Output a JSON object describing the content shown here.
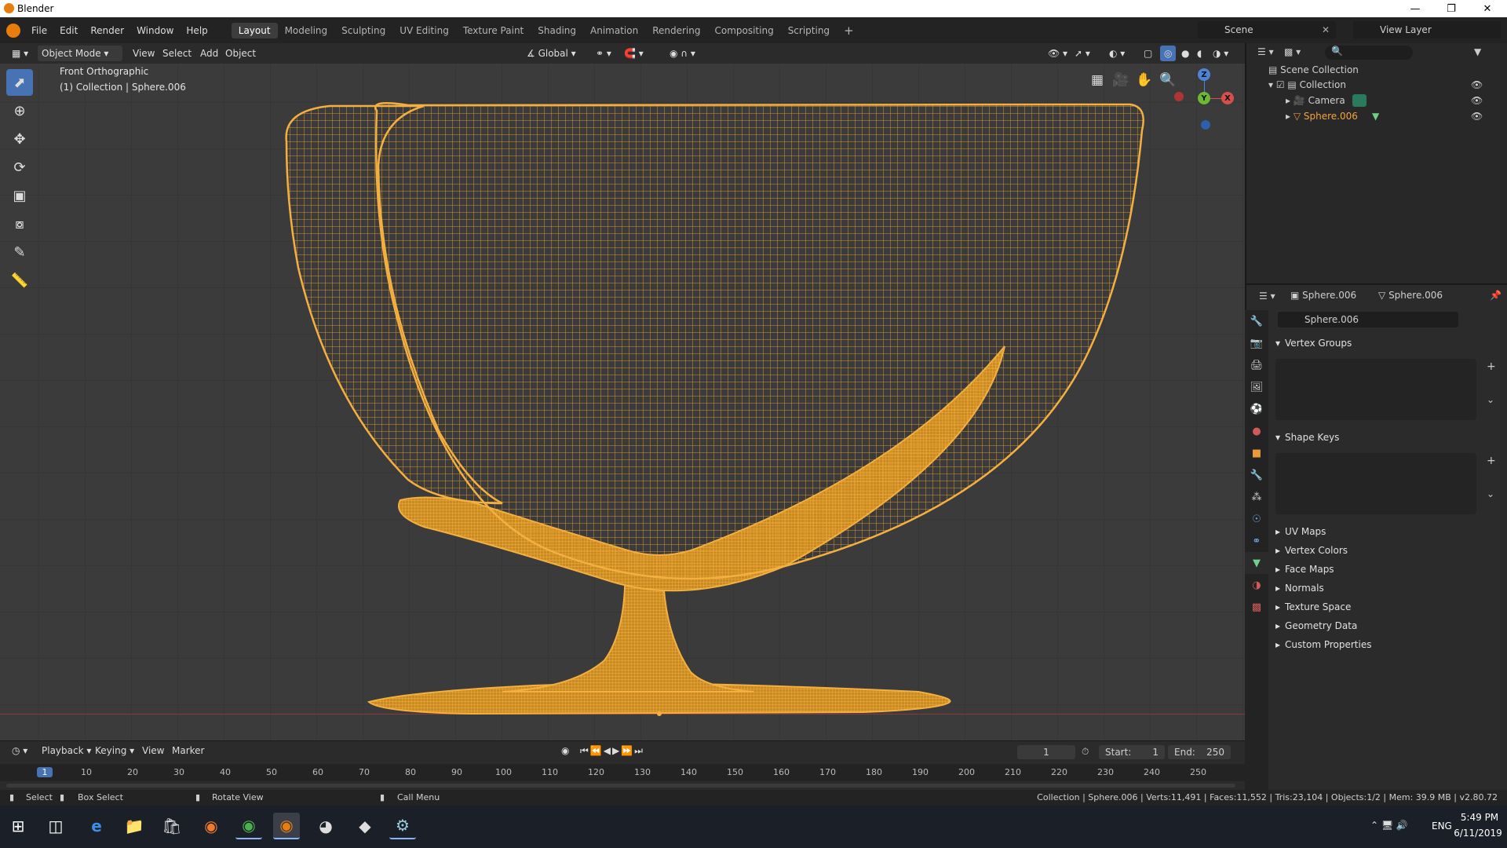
{
  "window": {
    "title": "Blender"
  },
  "menus": [
    "File",
    "Edit",
    "Render",
    "Window",
    "Help"
  ],
  "workspaces": [
    "Layout",
    "Modeling",
    "Sculpting",
    "UV Editing",
    "Texture Paint",
    "Shading",
    "Animation",
    "Rendering",
    "Compositing",
    "Scripting"
  ],
  "active_workspace": "Layout",
  "scene": {
    "name": "Scene",
    "view_layer": "View Layer"
  },
  "viewport_header": {
    "mode": "Object Mode",
    "menus": [
      "View",
      "Select",
      "Add",
      "Object"
    ],
    "transform": "Global"
  },
  "viewport": {
    "view_name": "Front Orthographic",
    "collection_info": "(1) Collection | Sphere.006"
  },
  "nav_gizmo": {
    "z": "Z",
    "y": "Y",
    "x": "X"
  },
  "outliner": {
    "root": "Scene Collection",
    "items": [
      {
        "label": "Collection"
      },
      {
        "label": "Camera"
      },
      {
        "label": "Sphere.006"
      }
    ]
  },
  "properties": {
    "object_name": "Sphere.006",
    "mesh_name": "Sphere.006",
    "data_field": "Sphere.006",
    "panels_open": [
      "Vertex Groups",
      "Shape Keys"
    ],
    "panels_closed": [
      "UV Maps",
      "Vertex Colors",
      "Face Maps",
      "Normals",
      "Texture Space",
      "Geometry Data",
      "Custom Properties"
    ]
  },
  "timeline": {
    "menus": [
      "Playback",
      "Keying",
      "View",
      "Marker"
    ],
    "current_frame": "1",
    "start_label": "Start:",
    "start": "1",
    "end_label": "End:",
    "end": "250",
    "ticks": [
      "1",
      "10",
      "20",
      "30",
      "40",
      "50",
      "60",
      "70",
      "80",
      "90",
      "100",
      "110",
      "120",
      "130",
      "140",
      "150",
      "160",
      "170",
      "180",
      "190",
      "200",
      "210",
      "220",
      "230",
      "240",
      "250"
    ]
  },
  "statusbar": {
    "select": "Select",
    "box_select": "Box Select",
    "rotate_view": "Rotate View",
    "call_menu": "Call Menu",
    "stats": "Collection | Sphere.006 | Verts:11,491 | Faces:11,552 | Tris:23,104 | Objects:1/2 | Mem: 39.9 MB | v2.80.72"
  },
  "taskbar": {
    "lang": "ENG",
    "time": "5:49 PM",
    "date": "6/11/2019"
  },
  "colors": {
    "wire": "#f0a030",
    "active_blue": "#4772b3",
    "viewport_bg": "#3b3b3b"
  }
}
